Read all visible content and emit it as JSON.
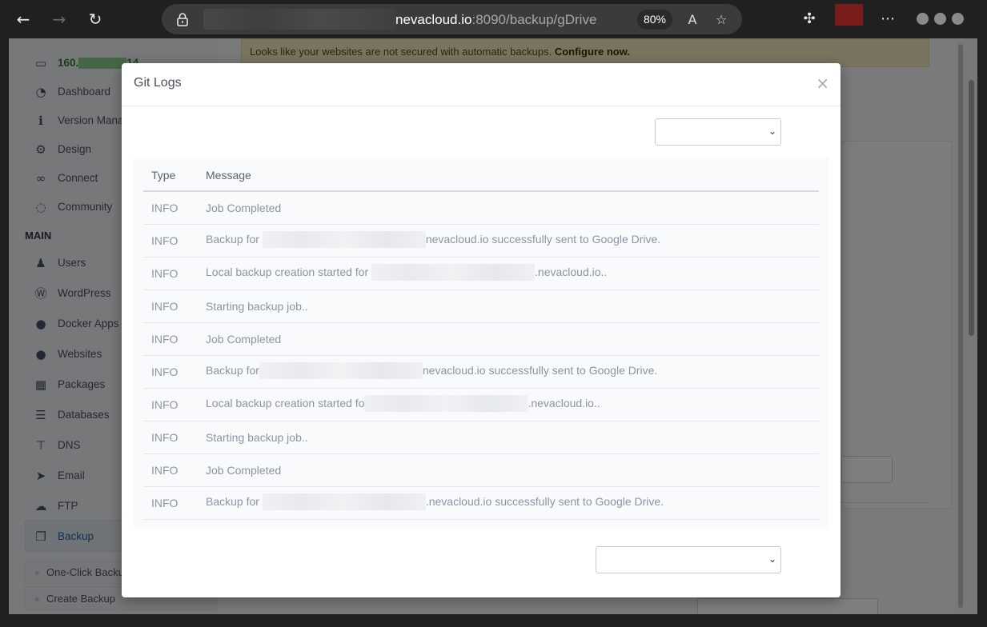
{
  "browser": {
    "url_host": "nevacloud.io",
    "url_rest": ":8090/backup/gDrive",
    "zoom": "80%",
    "icons": [
      "back-arrow-icon",
      "forward-arrow-icon",
      "reload-icon",
      "lock-icon",
      "translate-icon",
      "favorites-icon",
      "extensions-icon",
      "more-icon"
    ]
  },
  "sidebar": {
    "server_ip_prefix": "160.",
    "server_ip_suffix": "14",
    "main_heading": "MAIN",
    "items_top": [
      {
        "label": "Dashboard",
        "icon": "tachometer-icon"
      },
      {
        "label": "Version Mana",
        "icon": "info-icon"
      },
      {
        "label": "Design",
        "icon": "gear-icon"
      },
      {
        "label": "Connect",
        "icon": "link-icon"
      },
      {
        "label": "Community",
        "icon": "comments-icon"
      }
    ],
    "items_main": [
      {
        "label": "Users",
        "icon": "users-icon"
      },
      {
        "label": "WordPress",
        "icon": "wordpress-icon"
      },
      {
        "label": "Docker Apps",
        "icon": "globe-icon"
      },
      {
        "label": "Websites",
        "icon": "globe-icon"
      },
      {
        "label": "Packages",
        "icon": "cubes-icon"
      },
      {
        "label": "Databases",
        "icon": "database-icon"
      },
      {
        "label": "DNS",
        "icon": "sitemap-icon"
      },
      {
        "label": "Email",
        "icon": "paper-plane-icon"
      },
      {
        "label": "FTP",
        "icon": "cloud-upload-icon"
      },
      {
        "label": "Backup",
        "icon": "copy-icon"
      }
    ],
    "backup_sub": [
      "One-Click Backu",
      "Create Backup"
    ]
  },
  "banner": {
    "text": "Looks like your websites are not secured with automatic backups.",
    "link": "Configure now."
  },
  "modal": {
    "title": "Git Logs",
    "close": "×",
    "columns": [
      "Type",
      "Message"
    ],
    "rows": [
      {
        "type": "INFO",
        "pre": "Job Completed",
        "post": "",
        "blur": false
      },
      {
        "type": "INFO",
        "pre": "Backup for ",
        "post": "nevacloud.io successfully sent to Google Drive.",
        "blur": true
      },
      {
        "type": "INFO",
        "pre": "Local backup creation started for ",
        "post": ".nevacloud.io..",
        "blur": true
      },
      {
        "type": "INFO",
        "pre": "Starting backup job..",
        "post": "",
        "blur": false
      },
      {
        "type": "INFO",
        "pre": "Job Completed",
        "post": "",
        "blur": false
      },
      {
        "type": "INFO",
        "pre": "Backup for",
        "post": "nevacloud.io successfully sent to Google Drive.",
        "blur": true
      },
      {
        "type": "INFO",
        "pre": "Local backup creation started fo",
        "post": ".nevacloud.io..",
        "blur": true
      },
      {
        "type": "INFO",
        "pre": "Starting backup job..",
        "post": "",
        "blur": false
      },
      {
        "type": "INFO",
        "pre": "Job Completed",
        "post": "",
        "blur": false
      },
      {
        "type": "INFO",
        "pre": "Backup for ",
        "post": ".nevacloud.io successfully sent to Google Drive.",
        "blur": true
      }
    ]
  }
}
